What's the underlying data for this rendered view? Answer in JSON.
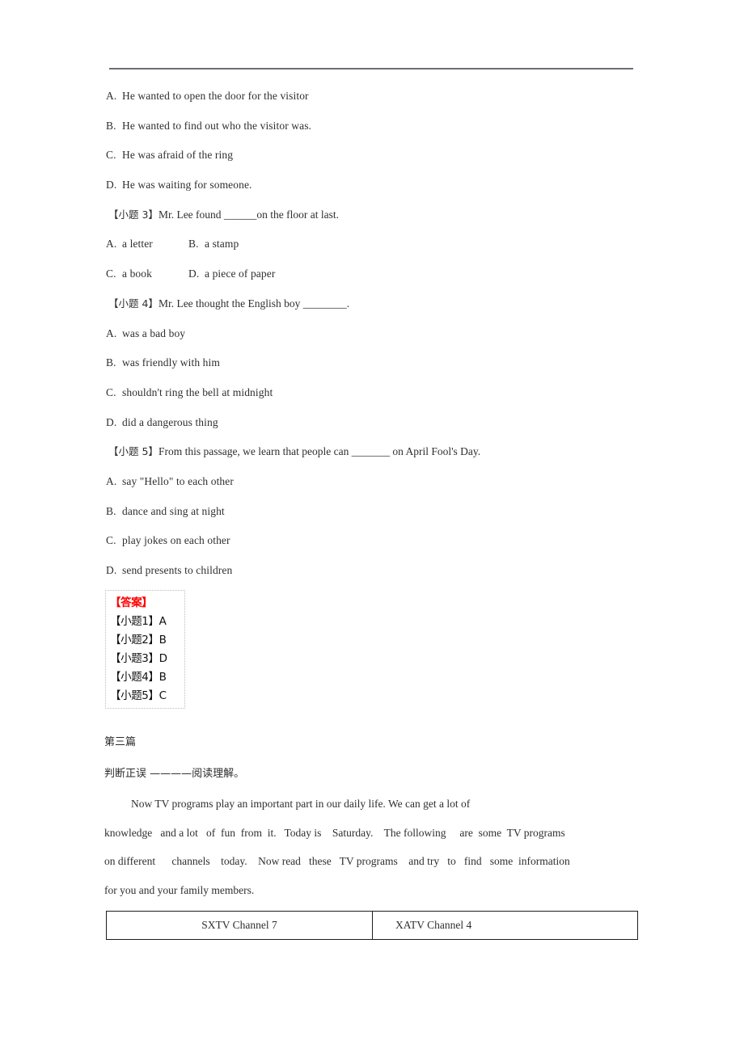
{
  "document": {
    "rule": "horizontal-rule",
    "question_2_options": [
      {
        "letter": "A.",
        "text": "He wanted to open the door for the visitor"
      },
      {
        "letter": "B.",
        "text": "He wanted to find out who the visitor was."
      },
      {
        "letter": "C.",
        "text": "He was afraid of the ring"
      },
      {
        "letter": "D.",
        "text": "He was waiting for someone."
      }
    ],
    "question_3": {
      "label": "【小题 3】",
      "stem": "Mr. Lee found ______on the floor at last.",
      "options_row1": [
        {
          "letter": "A.",
          "text": "a letter"
        },
        {
          "letter": "B.",
          "text": "a stamp"
        }
      ],
      "options_row2": [
        {
          "letter": "C.",
          "text": "a book"
        },
        {
          "letter": "D.",
          "text": "a piece of paper"
        }
      ]
    },
    "question_4": {
      "label": "【小题 4】",
      "stem": "Mr. Lee thought the English boy ________.",
      "options": [
        {
          "letter": "A.",
          "text": "was a bad boy"
        },
        {
          "letter": "B.",
          "text": "was friendly with him"
        },
        {
          "letter": "C.",
          "text": "shouldn't ring the bell at midnight"
        },
        {
          "letter": "D.",
          "text": "did a dangerous thing"
        }
      ]
    },
    "question_5": {
      "label": "【小题 5】",
      "stem": "From this passage, we learn that people can _______ on April Fool's Day.",
      "options": [
        {
          "letter": "A.",
          "text": "say \"Hello\" to each other"
        },
        {
          "letter": "B.",
          "text": "dance and sing at night"
        },
        {
          "letter": "C.",
          "text": "play jokes on each other"
        },
        {
          "letter": "D.",
          "text": "send presents to children"
        }
      ]
    },
    "answer_key": {
      "title": "【答案】",
      "title_color": "#ff0000",
      "rows": [
        "【小题1】A",
        "【小题2】B",
        "【小题3】D",
        "【小题4】B",
        "【小题5】C"
      ]
    },
    "section_three": {
      "title": "第三篇",
      "subtitle": "判断正误 ————阅读理解。",
      "passage_lines": [
        "Now TV programs play an important part in our daily life. We can get a lot of",
        "knowledge   and a lot   of  fun  from  it.   Today is    Saturday.    The following     are  some  TV programs",
        "on different      channels    today.    Now read   these   TV programs    and try   to   find   some  information",
        "for you and your family members."
      ]
    },
    "tv_table": {
      "cells": [
        "SXTV Channel 7",
        "XATV Channel 4"
      ]
    }
  }
}
